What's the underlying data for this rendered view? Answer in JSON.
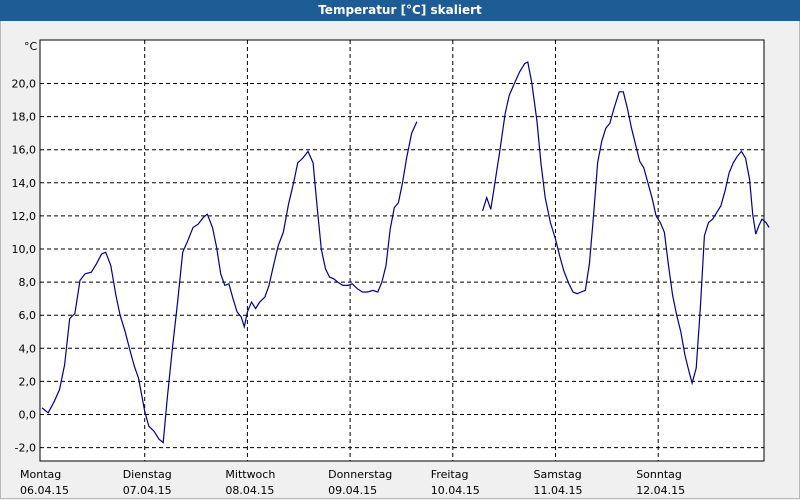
{
  "window": {
    "title": "Temperatur [°C] skaliert"
  },
  "chart_data": {
    "type": "line",
    "title": "Temperatur [°C] skaliert",
    "ylabel": "°C",
    "ylim": [
      -3,
      22.5
    ],
    "yticks": [
      "-2,0",
      "0,0",
      "2,0",
      "4,0",
      "6,0",
      "8,0",
      "10,0",
      "12,0",
      "14,0",
      "16,0",
      "18,0",
      "20,0"
    ],
    "ytick_values": [
      -2,
      0,
      2,
      4,
      6,
      8,
      10,
      12,
      14,
      16,
      18,
      20
    ],
    "xlim": [
      0,
      7
    ],
    "xticks": [
      {
        "day": "Montag",
        "date": "06.04.15"
      },
      {
        "day": "Dienstag",
        "date": "07.04.15"
      },
      {
        "day": "Mittwoch",
        "date": "08.04.15"
      },
      {
        "day": "Donnerstag",
        "date": "09.04.15"
      },
      {
        "day": "Freitag",
        "date": "10.04.15"
      },
      {
        "day": "Samstag",
        "date": "11.04.15"
      },
      {
        "day": "Sonntag",
        "date": "12.04.15"
      }
    ],
    "grid": true,
    "line_color": "#00008b",
    "series": [
      {
        "segments": [
          [
            [
              0.0,
              0.4
            ],
            [
              0.06,
              0.1
            ],
            [
              0.12,
              0.8
            ],
            [
              0.17,
              1.5
            ],
            [
              0.22,
              3.0
            ],
            [
              0.27,
              5.8
            ],
            [
              0.32,
              6.1
            ],
            [
              0.37,
              8.1
            ],
            [
              0.42,
              8.5
            ],
            [
              0.48,
              8.6
            ],
            [
              0.53,
              9.1
            ],
            [
              0.58,
              9.7
            ],
            [
              0.62,
              9.8
            ],
            [
              0.67,
              9.0
            ],
            [
              0.72,
              7.2
            ],
            [
              0.76,
              6.0
            ],
            [
              0.81,
              5.0
            ],
            [
              0.86,
              3.8
            ],
            [
              0.9,
              2.9
            ],
            [
              0.94,
              2.2
            ],
            [
              0.97,
              1.2
            ],
            [
              1.0,
              0.2
            ],
            [
              1.04,
              -0.7
            ],
            [
              1.09,
              -1.0
            ],
            [
              1.14,
              -1.5
            ],
            [
              1.18,
              -1.7
            ],
            [
              1.22,
              1.0
            ],
            [
              1.27,
              4.0
            ],
            [
              1.32,
              6.8
            ],
            [
              1.37,
              9.8
            ],
            [
              1.42,
              10.5
            ],
            [
              1.47,
              11.3
            ],
            [
              1.52,
              11.5
            ],
            [
              1.57,
              11.9
            ],
            [
              1.61,
              12.1
            ],
            [
              1.66,
              11.3
            ],
            [
              1.7,
              10.1
            ],
            [
              1.74,
              8.5
            ],
            [
              1.78,
              7.8
            ],
            [
              1.82,
              7.9
            ],
            [
              1.86,
              7.0
            ],
            [
              1.9,
              6.2
            ],
            [
              1.94,
              5.9
            ],
            [
              1.97,
              5.3
            ],
            [
              2.0,
              6.2
            ],
            [
              2.04,
              6.8
            ],
            [
              2.08,
              6.4
            ],
            [
              2.12,
              6.8
            ],
            [
              2.17,
              7.1
            ],
            [
              2.21,
              7.8
            ],
            [
              2.25,
              8.9
            ],
            [
              2.3,
              10.2
            ],
            [
              2.35,
              11.0
            ],
            [
              2.4,
              12.7
            ],
            [
              2.45,
              14.0
            ],
            [
              2.49,
              15.2
            ],
            [
              2.54,
              15.5
            ],
            [
              2.59,
              15.9
            ],
            [
              2.64,
              15.2
            ],
            [
              2.68,
              12.5
            ],
            [
              2.72,
              10.0
            ],
            [
              2.76,
              8.8
            ],
            [
              2.8,
              8.3
            ],
            [
              2.84,
              8.2
            ],
            [
              2.88,
              8.0
            ],
            [
              2.93,
              7.8
            ],
            [
              2.98,
              7.8
            ],
            [
              3.02,
              7.9
            ],
            [
              3.07,
              7.6
            ],
            [
              3.12,
              7.4
            ],
            [
              3.17,
              7.4
            ],
            [
              3.22,
              7.5
            ],
            [
              3.27,
              7.4
            ],
            [
              3.31,
              8.0
            ],
            [
              3.35,
              9.0
            ],
            [
              3.39,
              11.2
            ],
            [
              3.43,
              12.5
            ],
            [
              3.47,
              12.8
            ],
            [
              3.51,
              14.0
            ],
            [
              3.55,
              15.5
            ],
            [
              3.6,
              17.0
            ],
            [
              3.65,
              17.7
            ]
          ],
          [
            [
              4.29,
              12.3
            ],
            [
              4.33,
              13.1
            ],
            [
              4.37,
              12.4
            ],
            [
              4.41,
              14.0
            ],
            [
              4.46,
              16.0
            ],
            [
              4.51,
              18.2
            ],
            [
              4.55,
              19.3
            ],
            [
              4.6,
              20.0
            ],
            [
              4.65,
              20.7
            ],
            [
              4.7,
              21.2
            ],
            [
              4.73,
              21.3
            ],
            [
              4.77,
              20.0
            ],
            [
              4.82,
              17.7
            ],
            [
              4.86,
              15.1
            ],
            [
              4.9,
              13.1
            ],
            [
              4.95,
              11.6
            ],
            [
              5.0,
              10.6
            ],
            [
              5.04,
              9.6
            ],
            [
              5.08,
              8.7
            ],
            [
              5.13,
              7.9
            ],
            [
              5.17,
              7.4
            ],
            [
              5.21,
              7.3
            ],
            [
              5.25,
              7.4
            ],
            [
              5.29,
              7.5
            ],
            [
              5.33,
              9.1
            ],
            [
              5.37,
              12.0
            ],
            [
              5.41,
              15.2
            ],
            [
              5.45,
              16.5
            ],
            [
              5.49,
              17.3
            ],
            [
              5.53,
              17.6
            ],
            [
              5.57,
              18.5
            ],
            [
              5.62,
              19.5
            ],
            [
              5.66,
              19.5
            ],
            [
              5.7,
              18.5
            ],
            [
              5.74,
              17.3
            ],
            [
              5.78,
              16.3
            ],
            [
              5.82,
              15.3
            ],
            [
              5.86,
              14.9
            ],
            [
              5.9,
              14.0
            ],
            [
              5.94,
              13.1
            ],
            [
              5.98,
              12.0
            ],
            [
              6.02,
              11.6
            ],
            [
              6.06,
              11.0
            ],
            [
              6.1,
              9.0
            ],
            [
              6.14,
              7.2
            ],
            [
              6.18,
              6.0
            ],
            [
              6.22,
              5.0
            ],
            [
              6.26,
              3.6
            ],
            [
              6.3,
              2.6
            ],
            [
              6.33,
              1.9
            ],
            [
              6.37,
              2.8
            ],
            [
              6.41,
              6.4
            ],
            [
              6.45,
              10.8
            ],
            [
              6.49,
              11.6
            ],
            [
              6.53,
              11.8
            ],
            [
              6.57,
              12.2
            ],
            [
              6.61,
              12.6
            ],
            [
              6.65,
              13.5
            ],
            [
              6.69,
              14.6
            ],
            [
              6.73,
              15.2
            ],
            [
              6.77,
              15.6
            ],
            [
              6.81,
              15.9
            ],
            [
              6.85,
              15.5
            ],
            [
              6.89,
              14.2
            ],
            [
              6.92,
              12.1
            ],
            [
              6.95,
              10.9
            ],
            [
              6.98,
              11.4
            ],
            [
              7.01,
              11.8
            ],
            [
              7.05,
              11.6
            ],
            [
              7.08,
              11.3
            ]
          ]
        ]
      }
    ]
  }
}
